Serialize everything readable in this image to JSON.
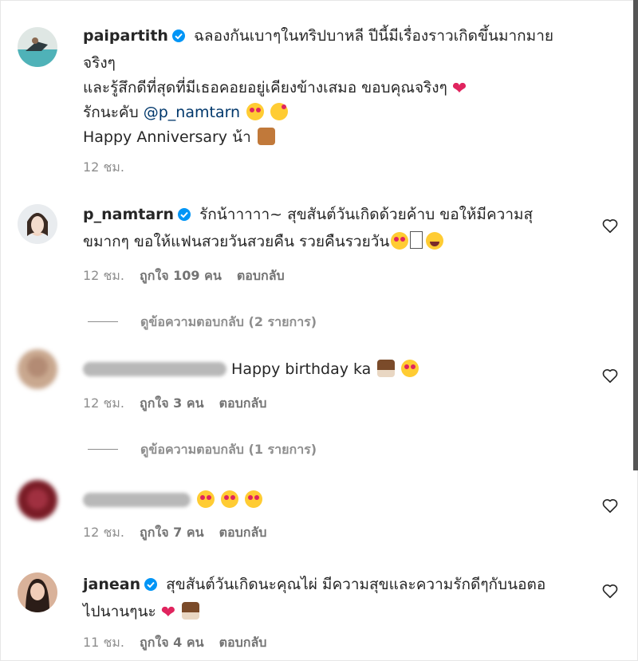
{
  "comments": [
    {
      "username": "paipartith",
      "lines": [
        "ฉลองกันเบาๆในทริปบาหลี ปีนี้มีเรื่องราวเกิดขึ้นมากมาย",
        "จริงๆ",
        "และรู้สึกดีที่สุดที่มีเธอคอยอยู่เคียงข้างเสมอ ขอบคุณจริงๆ",
        "รักนะคับ",
        "Happy Anniversary น้า"
      ],
      "mention": "@p_namtarn",
      "time": "12 ชม."
    },
    {
      "username": "p_namtarn",
      "line1": "รักน้าาาาา~ สุขสันต์วันเกิดด้วยค้าบ ขอให้มีความสุ",
      "line2": "ขมากๆ ขอให้แฟนสวยวันสวยคืน รวยคืนรวยวัน",
      "time": "12 ชม.",
      "likes": "ถูกใจ 109 คน",
      "reply": "ตอบกลับ",
      "view_replies": "ดูข้อความตอบกลับ (2 รายการ)"
    },
    {
      "text": "Happy birthday ka",
      "time": "12 ชม.",
      "likes": "ถูกใจ 3 คน",
      "reply": "ตอบกลับ",
      "view_replies": "ดูข้อความตอบกลับ (1 รายการ)"
    },
    {
      "time": "12 ชม.",
      "likes": "ถูกใจ 7 คน",
      "reply": "ตอบกลับ"
    },
    {
      "username": "janean",
      "line1": "สุขสันต์วันเกิดนะคุณไผ่ มีความสุขและความรักดีๆกับนอตอ",
      "line2": "ไปนานๆนะ",
      "time": "11 ชม.",
      "likes": "ถูกใจ 4 คน",
      "reply": "ตอบกลับ"
    }
  ],
  "colors": {
    "verified": "#0095f6",
    "mention": "#00376b",
    "meta": "#8e8e8e",
    "text": "#262626"
  },
  "icons": [
    "verified-badge-icon",
    "heart-outline-icon"
  ]
}
